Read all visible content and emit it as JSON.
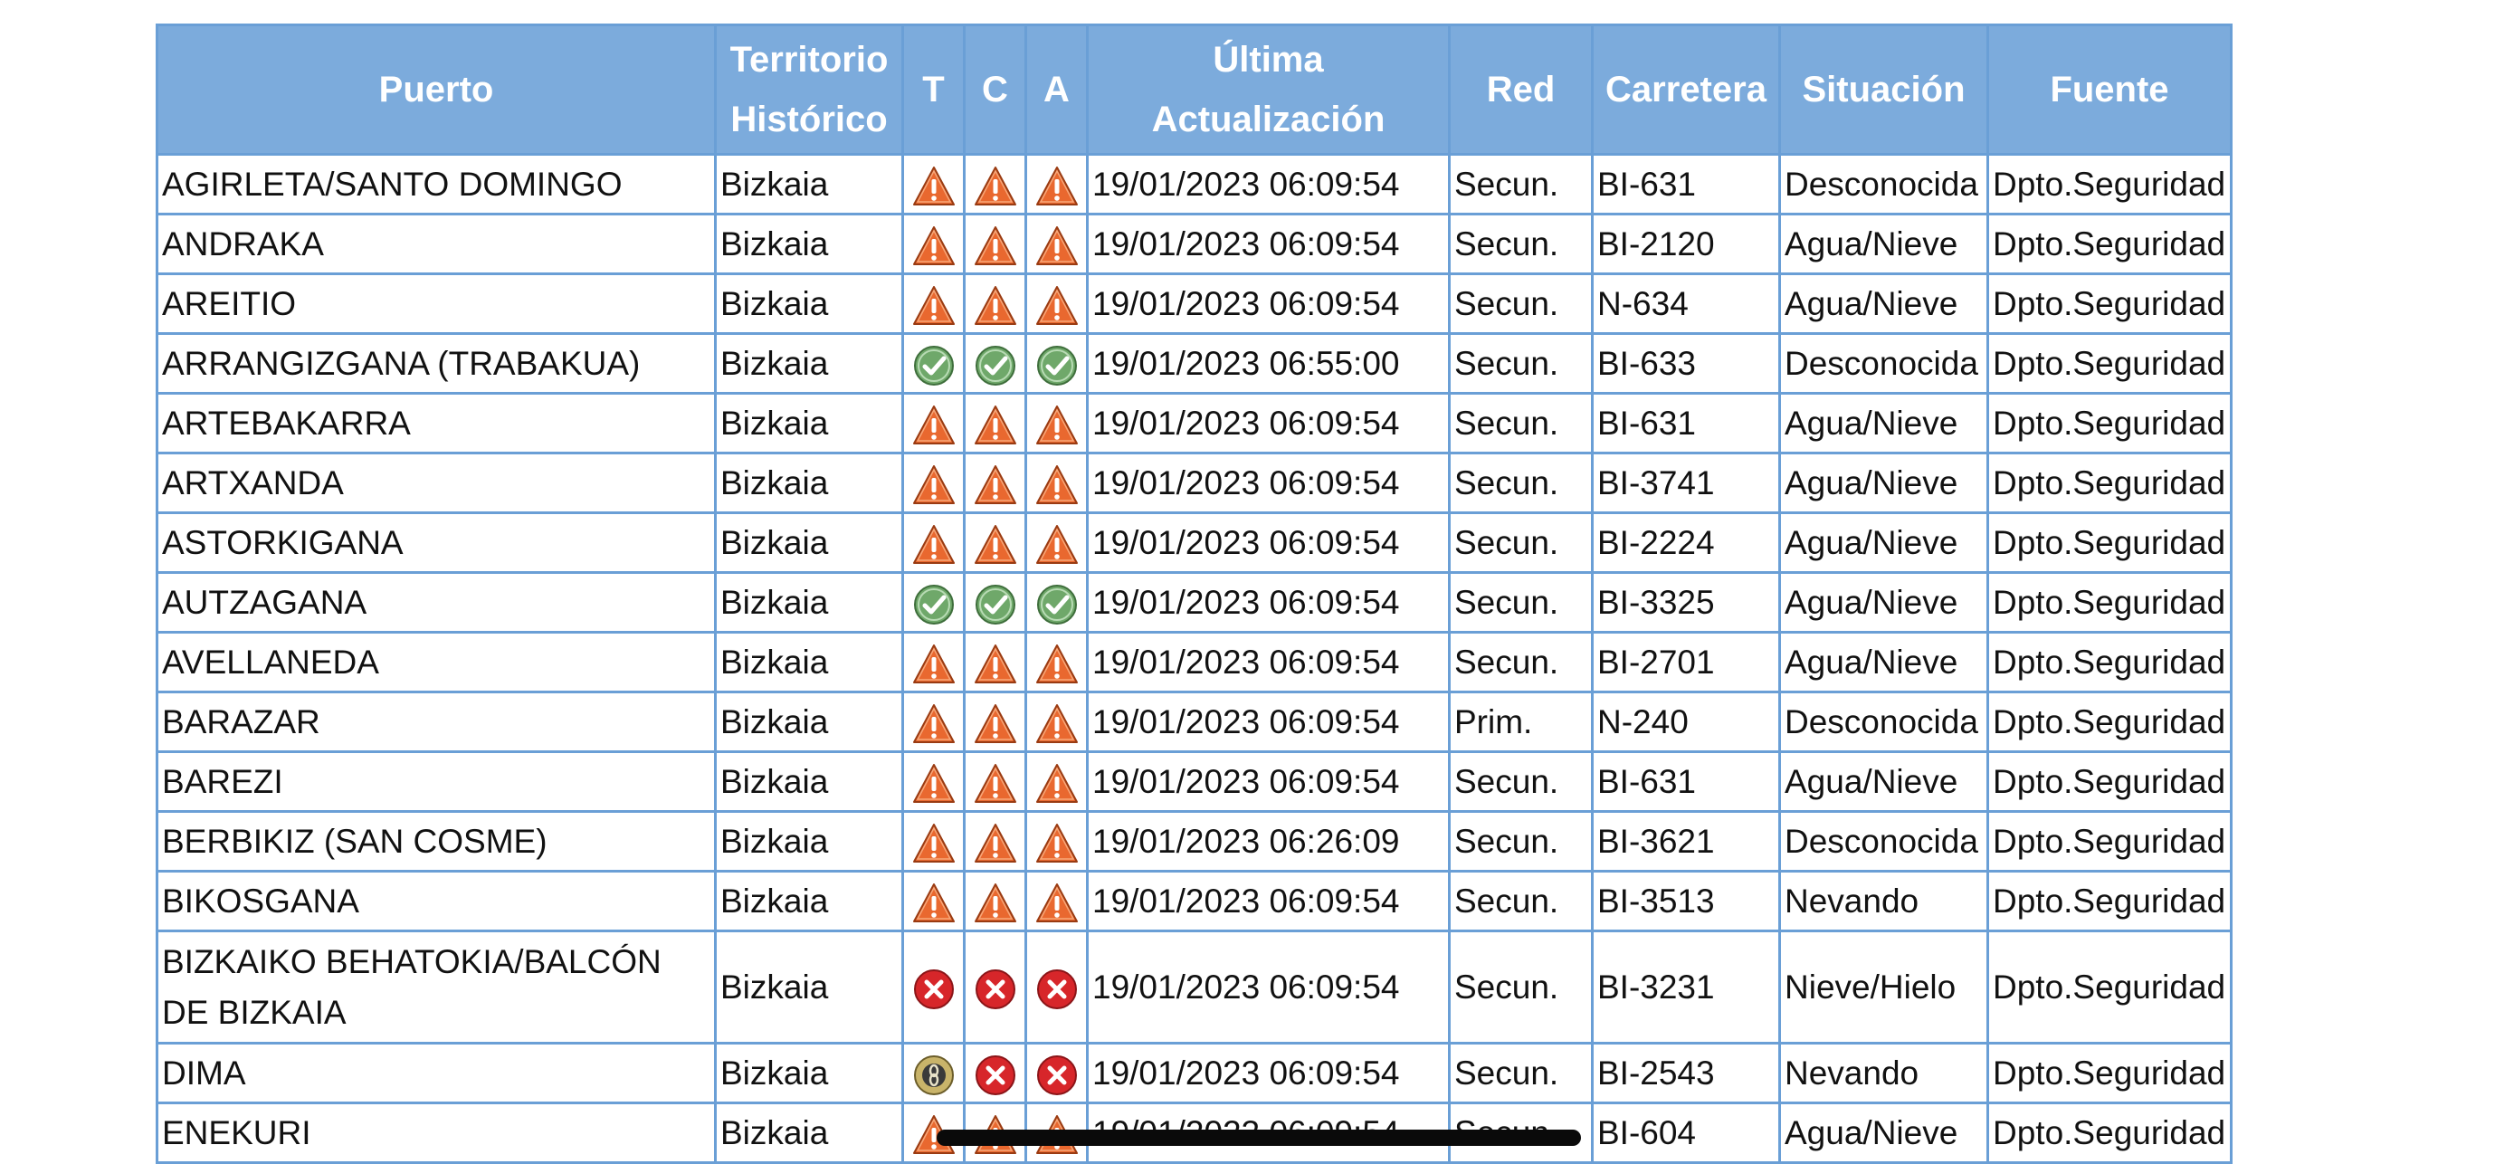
{
  "table": {
    "headers": {
      "puerto": "Puerto",
      "territorio_1": "Territorio",
      "territorio_2": "Histórico",
      "t": "T",
      "c": "C",
      "a": "A",
      "ultima_1": "Última",
      "ultima_2": "Actualización",
      "red": "Red",
      "carretera": "Carretera",
      "situacion": "Situación",
      "fuente": "Fuente"
    },
    "icon_legend": {
      "warn": "warning-triangle-icon",
      "ok": "check-circle-icon",
      "closed": "x-circle-icon",
      "chains": "chains-circle-icon"
    },
    "colors": {
      "header_bg": "#7cabdc",
      "border": "#6a9fd6",
      "warn": "#e9682f",
      "ok": "#6fa86a",
      "closed": "#d7262a",
      "chains": "#c9b46a"
    },
    "rows": [
      {
        "puerto": "AGIRLETA/SANTO DOMINGO",
        "territorio": "Bizkaia",
        "t": "warn",
        "c": "warn",
        "a": "warn",
        "fecha": "19/01/2023 06:09:54",
        "red": "Secun.",
        "carretera": "BI-631",
        "situacion": "Desconocida",
        "fuente": "Dpto.Seguridad"
      },
      {
        "puerto": "ANDRAKA",
        "territorio": "Bizkaia",
        "t": "warn",
        "c": "warn",
        "a": "warn",
        "fecha": "19/01/2023 06:09:54",
        "red": "Secun.",
        "carretera": "BI-2120",
        "situacion": "Agua/Nieve",
        "fuente": "Dpto.Seguridad"
      },
      {
        "puerto": "AREITIO",
        "territorio": "Bizkaia",
        "t": "warn",
        "c": "warn",
        "a": "warn",
        "fecha": "19/01/2023 06:09:54",
        "red": "Secun.",
        "carretera": "N-634",
        "situacion": "Agua/Nieve",
        "fuente": "Dpto.Seguridad"
      },
      {
        "puerto": "ARRANGIZGANA (TRABAKUA)",
        "territorio": "Bizkaia",
        "t": "ok",
        "c": "ok",
        "a": "ok",
        "fecha": "19/01/2023 06:55:00",
        "red": "Secun.",
        "carretera": "BI-633",
        "situacion": "Desconocida",
        "fuente": "Dpto.Seguridad"
      },
      {
        "puerto": "ARTEBAKARRA",
        "territorio": "Bizkaia",
        "t": "warn",
        "c": "warn",
        "a": "warn",
        "fecha": "19/01/2023 06:09:54",
        "red": "Secun.",
        "carretera": "BI-631",
        "situacion": "Agua/Nieve",
        "fuente": "Dpto.Seguridad"
      },
      {
        "puerto": "ARTXANDA",
        "territorio": "Bizkaia",
        "t": "warn",
        "c": "warn",
        "a": "warn",
        "fecha": "19/01/2023 06:09:54",
        "red": "Secun.",
        "carretera": "BI-3741",
        "situacion": "Agua/Nieve",
        "fuente": "Dpto.Seguridad"
      },
      {
        "puerto": "ASTORKIGANA",
        "territorio": "Bizkaia",
        "t": "warn",
        "c": "warn",
        "a": "warn",
        "fecha": "19/01/2023 06:09:54",
        "red": "Secun.",
        "carretera": "BI-2224",
        "situacion": "Agua/Nieve",
        "fuente": "Dpto.Seguridad"
      },
      {
        "puerto": "AUTZAGANA",
        "territorio": "Bizkaia",
        "t": "ok",
        "c": "ok",
        "a": "ok",
        "fecha": "19/01/2023 06:09:54",
        "red": "Secun.",
        "carretera": "BI-3325",
        "situacion": "Agua/Nieve",
        "fuente": "Dpto.Seguridad"
      },
      {
        "puerto": "AVELLANEDA",
        "territorio": "Bizkaia",
        "t": "warn",
        "c": "warn",
        "a": "warn",
        "fecha": "19/01/2023 06:09:54",
        "red": "Secun.",
        "carretera": "BI-2701",
        "situacion": "Agua/Nieve",
        "fuente": "Dpto.Seguridad"
      },
      {
        "puerto": "BARAZAR",
        "territorio": "Bizkaia",
        "t": "warn",
        "c": "warn",
        "a": "warn",
        "fecha": "19/01/2023 06:09:54",
        "red": "Prim.",
        "carretera": "N-240",
        "situacion": "Desconocida",
        "fuente": "Dpto.Seguridad"
      },
      {
        "puerto": "BAREZI",
        "territorio": "Bizkaia",
        "t": "warn",
        "c": "warn",
        "a": "warn",
        "fecha": "19/01/2023 06:09:54",
        "red": "Secun.",
        "carretera": "BI-631",
        "situacion": "Agua/Nieve",
        "fuente": "Dpto.Seguridad"
      },
      {
        "puerto": "BERBIKIZ (SAN COSME)",
        "territorio": "Bizkaia",
        "t": "warn",
        "c": "warn",
        "a": "warn",
        "fecha": "19/01/2023 06:26:09",
        "red": "Secun.",
        "carretera": "BI-3621",
        "situacion": "Desconocida",
        "fuente": "Dpto.Seguridad"
      },
      {
        "puerto": "BIKOSGANA",
        "territorio": "Bizkaia",
        "t": "warn",
        "c": "warn",
        "a": "warn",
        "fecha": "19/01/2023 06:09:54",
        "red": "Secun.",
        "carretera": "BI-3513",
        "situacion": "Nevando",
        "fuente": "Dpto.Seguridad"
      },
      {
        "puerto": "BIZKAIKO BEHATOKIA/BALCÓN DE BIZKAIA",
        "territorio": "Bizkaia",
        "t": "closed",
        "c": "closed",
        "a": "closed",
        "fecha": "19/01/2023 06:09:54",
        "red": "Secun.",
        "carretera": "BI-3231",
        "situacion": "Nieve/Hielo",
        "fuente": "Dpto.Seguridad",
        "tall": true
      },
      {
        "puerto": "DIMA",
        "territorio": "Bizkaia",
        "t": "chains",
        "c": "closed",
        "a": "closed",
        "fecha": "19/01/2023 06:09:54",
        "red": "Secun.",
        "carretera": "BI-2543",
        "situacion": "Nevando",
        "fuente": "Dpto.Seguridad"
      },
      {
        "puerto": "ENEKURI",
        "territorio": "Bizkaia",
        "t": "warn",
        "c": "warn",
        "a": "warn",
        "fecha": "19/01/2023 06:09:54",
        "red": "Secun.",
        "carretera": "BI-604",
        "situacion": "Agua/Nieve",
        "fuente": "Dpto.Seguridad"
      }
    ]
  }
}
